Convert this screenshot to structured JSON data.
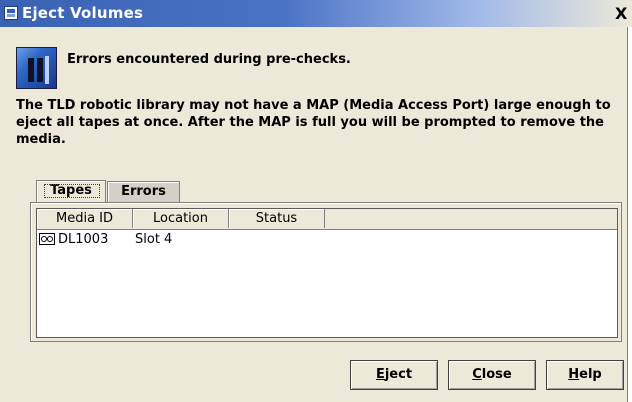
{
  "window": {
    "title": "Eject Volumes",
    "close_glyph": "X"
  },
  "message": {
    "icon": "tape-library-icon",
    "heading": "Errors encountered during pre-checks.",
    "description": "The TLD robotic library may not have a MAP (Media Access Port) large enough to eject all tapes at once.  After the MAP is full you will be prompted to remove the media."
  },
  "tabs": [
    {
      "label": "Tapes",
      "selected": true
    },
    {
      "label": "Errors",
      "selected": false
    }
  ],
  "table": {
    "columns": [
      "Media ID",
      "Location",
      "Status"
    ],
    "rows": [
      {
        "icon": "tape-cartridge-icon",
        "media_id": "DL1003",
        "location": "Slot 4",
        "status": ""
      }
    ]
  },
  "buttons": {
    "eject": {
      "label": "Eject",
      "mnemonic": "E",
      "rest": "ject"
    },
    "close": {
      "label": "Close",
      "mnemonic": "C",
      "rest": "lose"
    },
    "help": {
      "label": "Help",
      "mnemonic": "H",
      "rest": "elp"
    }
  }
}
